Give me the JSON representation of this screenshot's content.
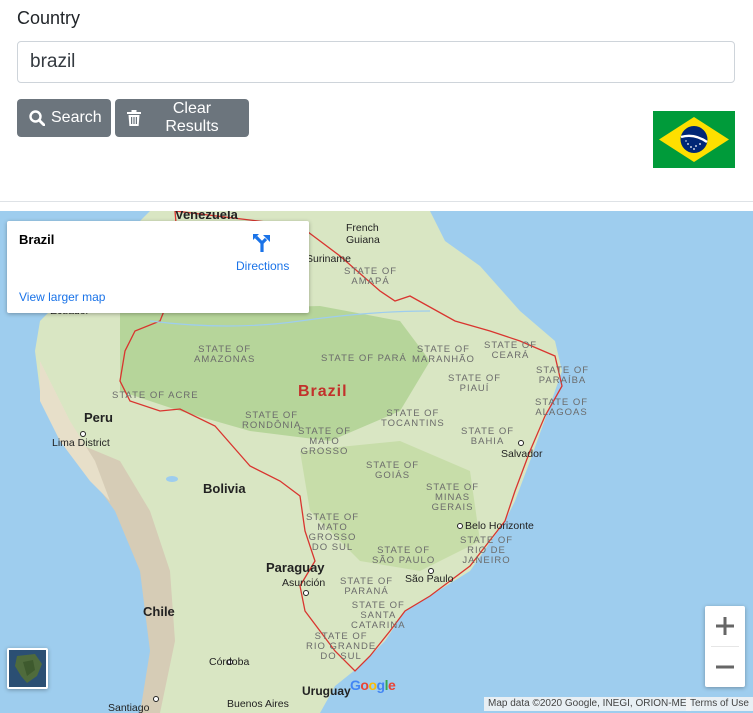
{
  "form": {
    "country_label": "Country",
    "country_value": "brazil",
    "search_label": "Search",
    "clear_label": "Clear Results"
  },
  "flag": {
    "country": "Brazil",
    "colors": {
      "green": "#009b3a",
      "yellow": "#fedf00",
      "blue": "#002776"
    }
  },
  "map": {
    "infocard": {
      "title": "Brazil",
      "directions": "Directions",
      "larger_map": "View larger map"
    },
    "main_label": "Brazil",
    "countries": [
      "Venezuela",
      "French Guiana",
      "Suriname",
      "Ecuador",
      "Peru",
      "Bolivia",
      "Paraguay",
      "Chile",
      "Uruguay"
    ],
    "states": [
      "STATE OF AMAPÁ",
      "STATE OF AMAZONAS",
      "STATE OF PARÁ",
      "STATE OF MARANHÃO",
      "STATE OF CEARÁ",
      "STATE OF PIAUÍ",
      "STATE OF PARAÍBA",
      "STATE OF ALAGOAS",
      "STATE OF ACRE",
      "STATE OF RONDÔNIA",
      "STATE OF TOCANTINS",
      "STATE OF BAHIA",
      "STATE OF MATO GROSSO",
      "STATE OF GOIÁS",
      "STATE OF MINAS GERAIS",
      "STATE OF MATO GROSSO DO SUL",
      "STATE OF RIO DE JANEIRO",
      "STATE OF SÃO PAULO",
      "STATE OF PARANÁ",
      "STATE OF SANTA CATARINA",
      "STATE OF RIO GRANDE DO SUL"
    ],
    "cities": [
      "Lima District",
      "Salvador",
      "Belo Horizonte",
      "São Paulo",
      "Asunción",
      "Córdoba",
      "Santiago",
      "Buenos Aires"
    ],
    "attribution": "Map data ©2020 Google, INEGI, ORION-ME",
    "terms": "Terms of Use",
    "google": "Google"
  }
}
